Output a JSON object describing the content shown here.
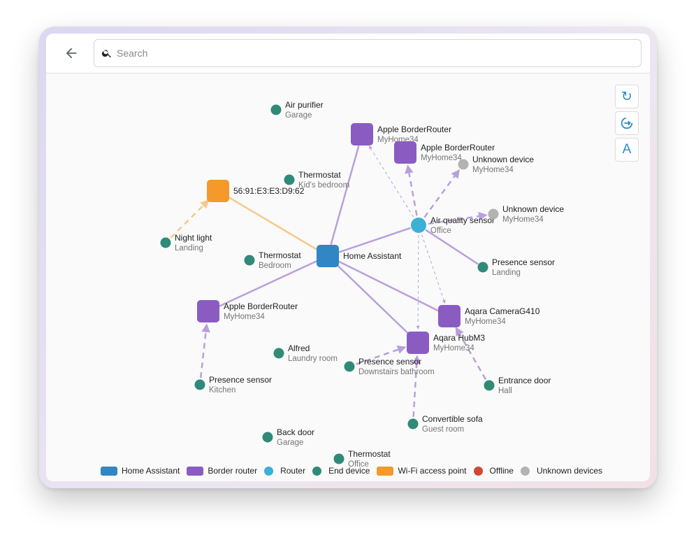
{
  "search": {
    "placeholder": "Search",
    "value": ""
  },
  "colors": {
    "home_assistant": "#3187c4",
    "border_router": "#8a5cc2",
    "router": "#3cb0d6",
    "end_device": "#2f8a78",
    "wifi_ap": "#f4992a",
    "offline": "#d24736",
    "unknown": "#b3b3b3"
  },
  "toolbar": {
    "icons": [
      "refresh-icon",
      "rotate-arrow-icon",
      "text-label-icon"
    ],
    "label_button": "A"
  },
  "nodes": [
    {
      "id": "ha",
      "type": "home_assistant",
      "name": "Home Assistant",
      "sub": ""
    },
    {
      "id": "br1",
      "type": "border_router",
      "name": "Apple BorderRouter",
      "sub": "MyHome34"
    },
    {
      "id": "br2",
      "type": "border_router",
      "name": "Apple BorderRouter",
      "sub": "MyHome34"
    },
    {
      "id": "br3",
      "type": "border_router",
      "name": "Apple BorderRouter",
      "sub": "MyHome34"
    },
    {
      "id": "aqcam",
      "type": "border_router",
      "name": "Aqara CameraG410",
      "sub": "MyHome34"
    },
    {
      "id": "aqhub",
      "type": "border_router",
      "name": "Aqara HubM3",
      "sub": "MyHome34"
    },
    {
      "id": "wifi",
      "type": "wifi_ap",
      "name": "56:91:E3:E3:D9:62",
      "sub": ""
    },
    {
      "id": "aqs",
      "type": "router",
      "name": "Air quality sensor",
      "sub": "Office"
    },
    {
      "id": "unk1",
      "type": "unknown",
      "name": "Unknown device",
      "sub": "MyHome34"
    },
    {
      "id": "unk2",
      "type": "unknown",
      "name": "Unknown device",
      "sub": "MyHome34"
    },
    {
      "id": "airp",
      "type": "end_device",
      "name": "Air purifier",
      "sub": "Garage"
    },
    {
      "id": "thkid",
      "type": "end_device",
      "name": "Thermostat",
      "sub": "Kid's bedroom"
    },
    {
      "id": "night",
      "type": "end_device",
      "name": "Night light",
      "sub": "Landing"
    },
    {
      "id": "thbed",
      "type": "end_device",
      "name": "Thermostat",
      "sub": "Bedroom"
    },
    {
      "id": "presland",
      "type": "end_device",
      "name": "Presence sensor",
      "sub": "Landing"
    },
    {
      "id": "alfred",
      "type": "end_device",
      "name": "Alfred",
      "sub": "Laundry room"
    },
    {
      "id": "presdown",
      "type": "end_device",
      "name": "Presence sensor",
      "sub": "Downstairs bathroom"
    },
    {
      "id": "preskit",
      "type": "end_device",
      "name": "Presence sensor",
      "sub": "Kitchen"
    },
    {
      "id": "entr",
      "type": "end_device",
      "name": "Entrance door",
      "sub": "Hall"
    },
    {
      "id": "sofa",
      "type": "end_device",
      "name": "Convertible sofa",
      "sub": "Guest room"
    },
    {
      "id": "backdoor",
      "type": "end_device",
      "name": "Back door",
      "sub": "Garage"
    },
    {
      "id": "thoff",
      "type": "end_device",
      "name": "Thermostat",
      "sub": "Office"
    }
  ],
  "edges": [
    {
      "from": "ha",
      "to": "wifi",
      "style": "solid",
      "color": "wifi_ap"
    },
    {
      "from": "ha",
      "to": "br1",
      "style": "solid",
      "color": "border_router"
    },
    {
      "from": "ha",
      "to": "aqs",
      "style": "solid",
      "color": "border_router"
    },
    {
      "from": "ha",
      "to": "br3",
      "style": "solid",
      "color": "border_router"
    },
    {
      "from": "ha",
      "to": "aqcam",
      "style": "solid",
      "color": "border_router"
    },
    {
      "from": "ha",
      "to": "aqhub",
      "style": "solid",
      "color": "border_router"
    },
    {
      "from": "aqs",
      "to": "presland",
      "style": "solid",
      "color": "border_router"
    },
    {
      "from": "night",
      "to": "wifi",
      "style": "dashed",
      "color": "wifi_ap"
    },
    {
      "from": "aqs",
      "to": "br2",
      "style": "dashed",
      "color": "border_router"
    },
    {
      "from": "aqs",
      "to": "unk1",
      "style": "dashed",
      "color": "border_router"
    },
    {
      "from": "aqs",
      "to": "unk2",
      "style": "dashed",
      "color": "border_router"
    },
    {
      "from": "aqs",
      "to": "br1",
      "style": "thin",
      "color": "border_router"
    },
    {
      "from": "aqs",
      "to": "aqhub",
      "style": "thin",
      "color": "border_router"
    },
    {
      "from": "aqs",
      "to": "aqcam",
      "style": "thin",
      "color": "border_router"
    },
    {
      "from": "preskit",
      "to": "br3",
      "style": "dashed",
      "color": "border_router"
    },
    {
      "from": "presdown",
      "to": "aqhub",
      "style": "dashed",
      "color": "border_router"
    },
    {
      "from": "sofa",
      "to": "aqhub",
      "style": "dashed",
      "color": "border_router"
    },
    {
      "from": "entr",
      "to": "aqcam",
      "style": "dashed",
      "color": "border_router"
    }
  ],
  "legend": [
    {
      "label": "Home Assistant",
      "shape": "rect",
      "color": "home_assistant"
    },
    {
      "label": "Border router",
      "shape": "rect",
      "color": "border_router"
    },
    {
      "label": "Router",
      "shape": "dot",
      "color": "router"
    },
    {
      "label": "End device",
      "shape": "dot",
      "color": "end_device"
    },
    {
      "label": "Wi-Fi access point",
      "shape": "rect",
      "color": "wifi_ap"
    },
    {
      "label": "Offline",
      "shape": "dot",
      "color": "offline"
    },
    {
      "label": "Unknown devices",
      "shape": "dot",
      "color": "unknown"
    }
  ]
}
